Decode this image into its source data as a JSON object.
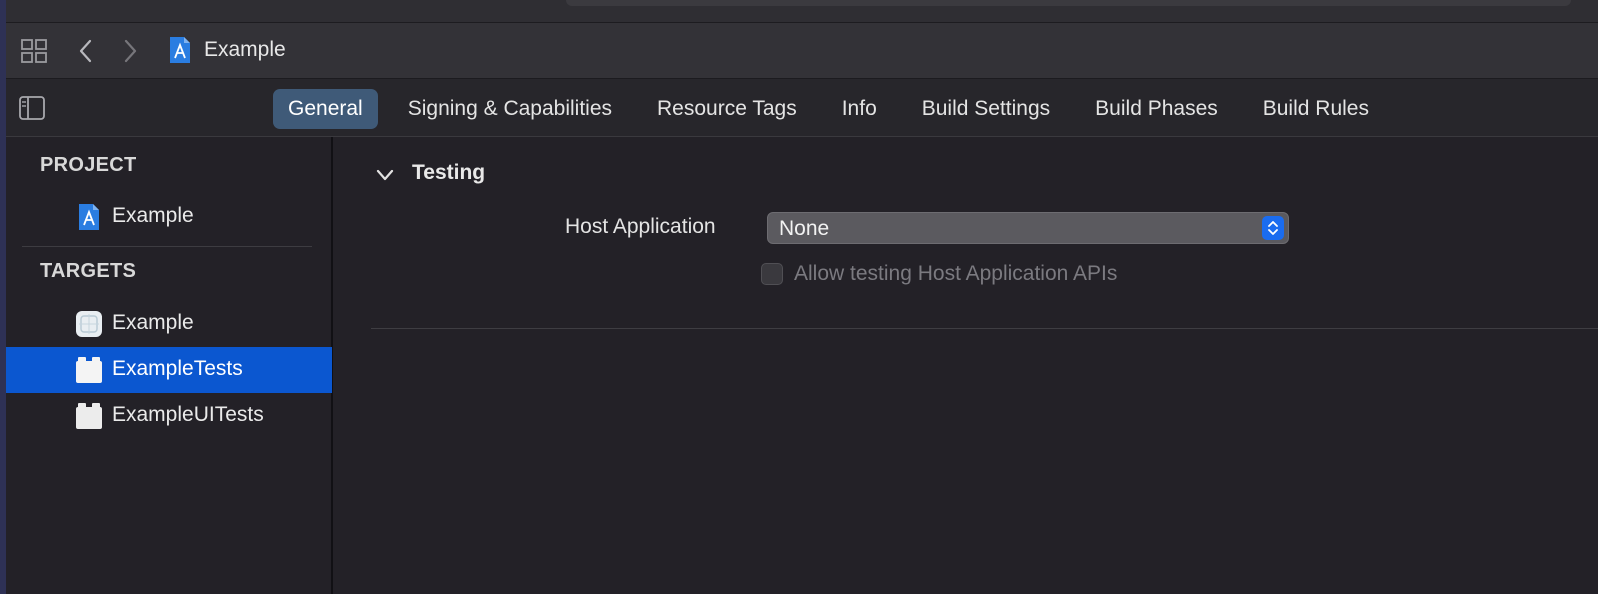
{
  "pathbar": {
    "breadcrumb": "Example"
  },
  "tabs": [
    {
      "label": "General",
      "active": true
    },
    {
      "label": "Signing & Capabilities",
      "active": false
    },
    {
      "label": "Resource Tags",
      "active": false
    },
    {
      "label": "Info",
      "active": false
    },
    {
      "label": "Build Settings",
      "active": false
    },
    {
      "label": "Build Phases",
      "active": false
    },
    {
      "label": "Build Rules",
      "active": false
    }
  ],
  "sidebar": {
    "project_section": "PROJECT",
    "project_item": "Example",
    "targets_section": "TARGETS",
    "targets": [
      {
        "label": "Example",
        "icon": "app-target-icon",
        "selected": false
      },
      {
        "label": "ExampleTests",
        "icon": "test-bundle-icon",
        "selected": true
      },
      {
        "label": "ExampleUITests",
        "icon": "test-bundle-icon",
        "selected": false
      }
    ]
  },
  "main": {
    "group_title": "Testing",
    "host_app_label": "Host Application",
    "host_app_value": "None",
    "allow_testing_label": "Allow testing Host Application APIs",
    "allow_testing_checked": false
  },
  "colors": {
    "accent": "#0b57d0",
    "active_tab": "#3f5a78",
    "popup_stepper": "#1a6cf0"
  }
}
